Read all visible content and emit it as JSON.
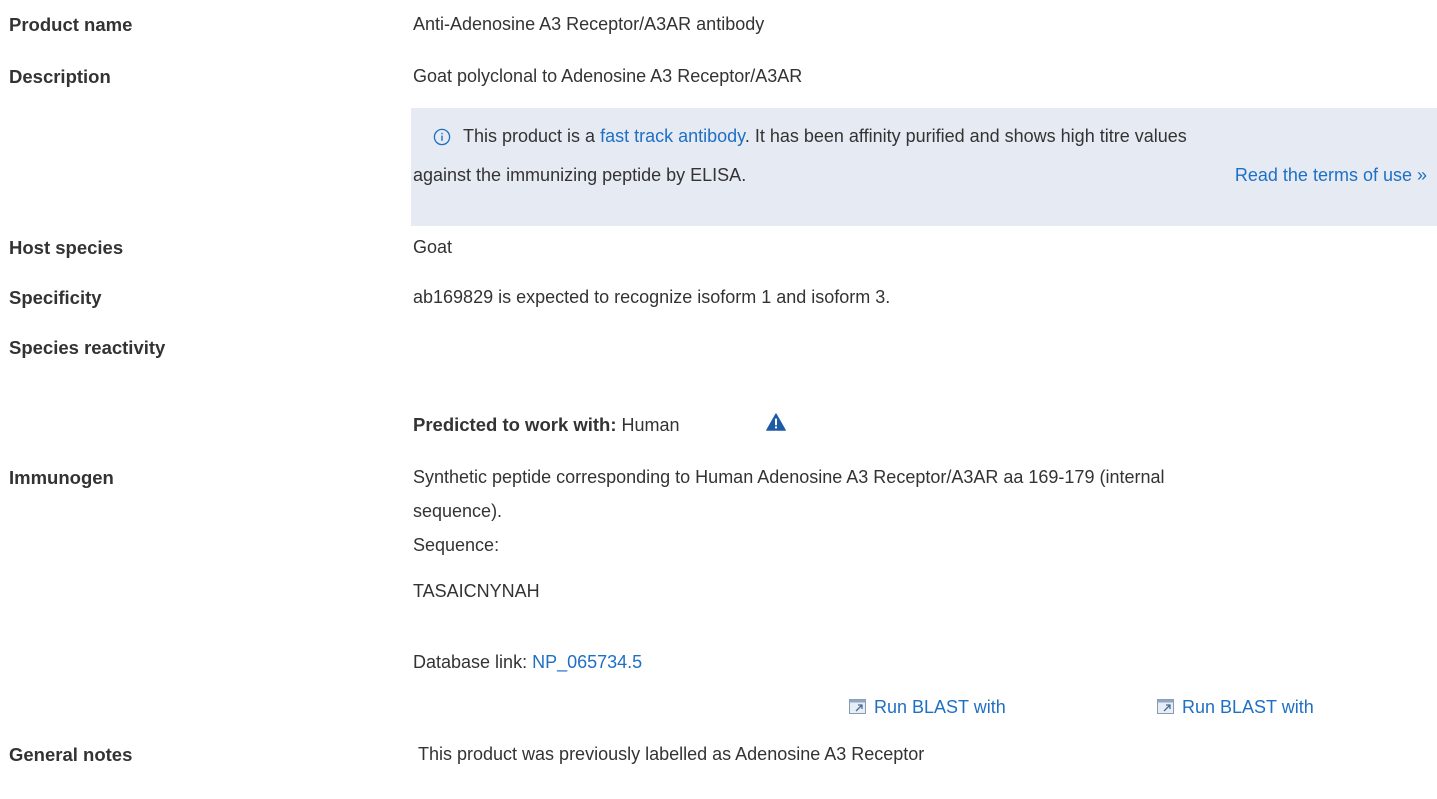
{
  "rows": {
    "product_name": {
      "label": "Product name",
      "value": "Anti-Adenosine A3 Receptor/A3AR antibody"
    },
    "description": {
      "label": "Description",
      "value": "Goat polyclonal to Adenosine A3 Receptor/A3AR"
    },
    "host_species": {
      "label": "Host species",
      "value": "Goat"
    },
    "specificity": {
      "label": "Specificity",
      "value": "ab169829 is expected to recognize isoform 1 and isoform 3."
    },
    "species_reactivity": {
      "label": "Species reactivity",
      "predicted_label": "Predicted to work with:",
      "predicted_value": "Human"
    },
    "immunogen": {
      "label": "Immunogen",
      "line1": "Synthetic peptide corresponding to Human Adenosine A3 Receptor/A3AR aa 169-179 (internal",
      "line2": "sequence).",
      "sequence_label": "Sequence:",
      "sequence": "TASAICNYNAH",
      "database_prefix": "Database link: ",
      "database_link": "NP_065734.5",
      "blast_1": "Run BLAST with",
      "blast_2": "Run BLAST with"
    },
    "general_notes": {
      "label": "General notes",
      "value": "This product was previously labelled as Adenosine A3 Receptor"
    }
  },
  "notice": {
    "text_before": "This product is a ",
    "link": "fast track antibody",
    "text_after": ". It has been affinity purified and shows high titre values",
    "line2": "against the immunizing peptide by ELISA.",
    "terms_link": "Read the terms of use »"
  },
  "colors": {
    "link": "#1f6fc5",
    "notice_bg": "#e6ebf3",
    "text": "#333333",
    "warning": "#1f5aa6"
  },
  "icons": {
    "info": "info-circle-icon",
    "warning": "warning-triangle-icon",
    "blast": "external-window-icon"
  }
}
